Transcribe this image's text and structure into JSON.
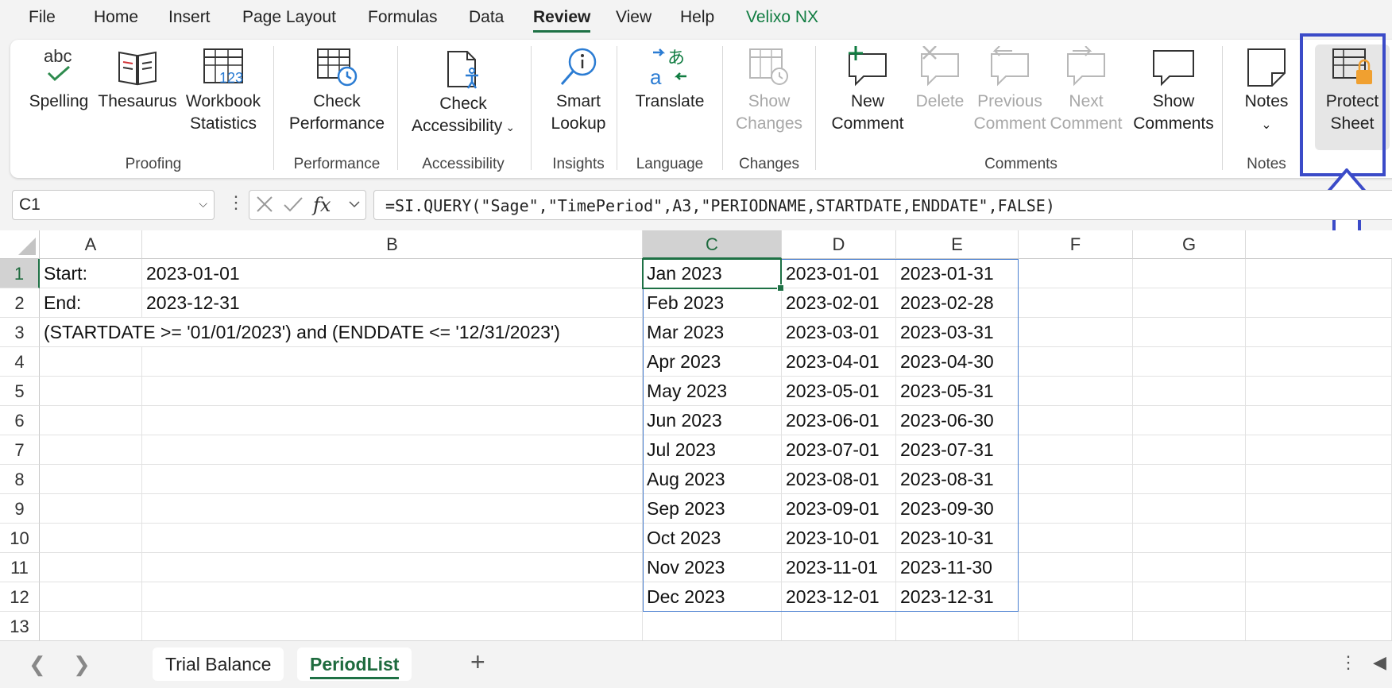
{
  "menu": [
    "File",
    "Home",
    "Insert",
    "Page Layout",
    "Formulas",
    "Data",
    "Review",
    "View",
    "Help",
    "Velixo NX"
  ],
  "active_menu": "Review",
  "ribbon": {
    "spelling": "Spelling",
    "thesaurus": "Thesaurus",
    "workbook_stats_1": "Workbook",
    "workbook_stats_2": "Statistics",
    "check_perf_1": "Check",
    "check_perf_2": "Performance",
    "check_access_1": "Check",
    "check_access_2": "Accessibility",
    "smart_lookup_1": "Smart",
    "smart_lookup_2": "Lookup",
    "translate": "Translate",
    "show_changes_1": "Show",
    "show_changes_2": "Changes",
    "new_comment_1": "New",
    "new_comment_2": "Comment",
    "delete": "Delete",
    "prev_comment_1": "Previous",
    "prev_comment_2": "Comment",
    "next_comment_1": "Next",
    "next_comment_2": "Comment",
    "show_comments_1": "Show",
    "show_comments_2": "Comments",
    "notes": "Notes",
    "protect_sheet_1": "Protect",
    "protect_sheet_2": "Sheet",
    "groups": {
      "proofing": "Proofing",
      "performance": "Performance",
      "accessibility": "Accessibility",
      "insights": "Insights",
      "language": "Language",
      "changes": "Changes",
      "comments": "Comments",
      "notes": "Notes"
    }
  },
  "formula_bar": {
    "name_box": "C1",
    "formula": "=SI.QUERY(\"Sage\",\"TimePeriod\",A3,\"PERIODNAME,STARTDATE,ENDDATE\",FALSE)"
  },
  "columns": [
    "A",
    "B",
    "C",
    "D",
    "E",
    "F",
    "G"
  ],
  "rows": [
    "1",
    "2",
    "3",
    "4",
    "5",
    "6",
    "7",
    "8",
    "9",
    "10",
    "11",
    "12",
    "13"
  ],
  "cells": {
    "A1": "Start:",
    "B1": "2023-01-01",
    "A2": "End:",
    "B2": "2023-12-31",
    "A3": "(STARTDATE >= '01/01/2023') and (ENDDATE <= '12/31/2023')"
  },
  "periods": [
    [
      "Jan 2023",
      "2023-01-01",
      "2023-01-31"
    ],
    [
      "Feb 2023",
      "2023-02-01",
      "2023-02-28"
    ],
    [
      "Mar 2023",
      "2023-03-01",
      "2023-03-31"
    ],
    [
      "Apr 2023",
      "2023-04-01",
      "2023-04-30"
    ],
    [
      "May 2023",
      "2023-05-01",
      "2023-05-31"
    ],
    [
      "Jun 2023",
      "2023-06-01",
      "2023-06-30"
    ],
    [
      "Jul 2023",
      "2023-07-01",
      "2023-07-31"
    ],
    [
      "Aug 2023",
      "2023-08-01",
      "2023-08-31"
    ],
    [
      "Sep 2023",
      "2023-09-01",
      "2023-09-30"
    ],
    [
      "Oct 2023",
      "2023-10-01",
      "2023-10-31"
    ],
    [
      "Nov 2023",
      "2023-11-01",
      "2023-11-30"
    ],
    [
      "Dec 2023",
      "2023-12-01",
      "2023-12-31"
    ]
  ],
  "sheet_tabs": [
    "Trial Balance",
    "PeriodList"
  ],
  "active_sheet": "PeriodList"
}
